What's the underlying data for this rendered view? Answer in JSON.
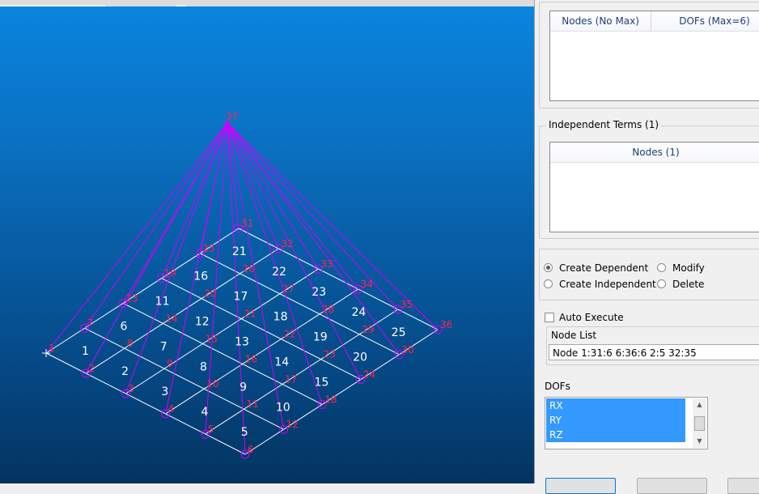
{
  "viewport": {
    "top_node": "37",
    "colors": {
      "mesh": "#ffffff",
      "cable": "#cc00ff",
      "node_label": "#ff2255",
      "node_marker": "#cc00ff",
      "element_label": "#ffffff"
    },
    "elements": [
      "1",
      "2",
      "3",
      "4",
      "5",
      "6",
      "7",
      "8",
      "9",
      "10",
      "11",
      "12",
      "13",
      "14",
      "15",
      "16",
      "17",
      "18",
      "19",
      "20",
      "21",
      "22",
      "23",
      "24",
      "25"
    ],
    "nodes": [
      "1",
      "2",
      "3",
      "4",
      "5",
      "6",
      "7",
      "8",
      "9",
      "10",
      "11",
      "12",
      "13",
      "14",
      "15",
      "16",
      "17",
      "18",
      "19",
      "20",
      "21",
      "22",
      "23",
      "24",
      "25",
      "26",
      "27",
      "28",
      "29",
      "30",
      "31",
      "32",
      "33",
      "34",
      "35",
      "36"
    ]
  },
  "panel": {
    "dependent_table": {
      "col_nodes": "Nodes (No Max)",
      "col_dofs": "DOFs (Max=6)"
    },
    "independent_terms": {
      "title": "Independent Terms (1)",
      "col_nodes": "Nodes (1)"
    },
    "mode": {
      "create_dependent": "Create Dependent",
      "create_independent": "Create Independent",
      "modify": "Modify",
      "delete": "Delete",
      "selected": "create_dependent"
    },
    "auto_execute": {
      "label": "Auto Execute",
      "checked": false
    },
    "node_list": {
      "label": "Node List",
      "value": "Node 1:31:6 6:36:6 2:5 32:35"
    },
    "dofs": {
      "label": "DOFs",
      "options": [
        "RX",
        "RY",
        "RZ"
      ]
    }
  }
}
